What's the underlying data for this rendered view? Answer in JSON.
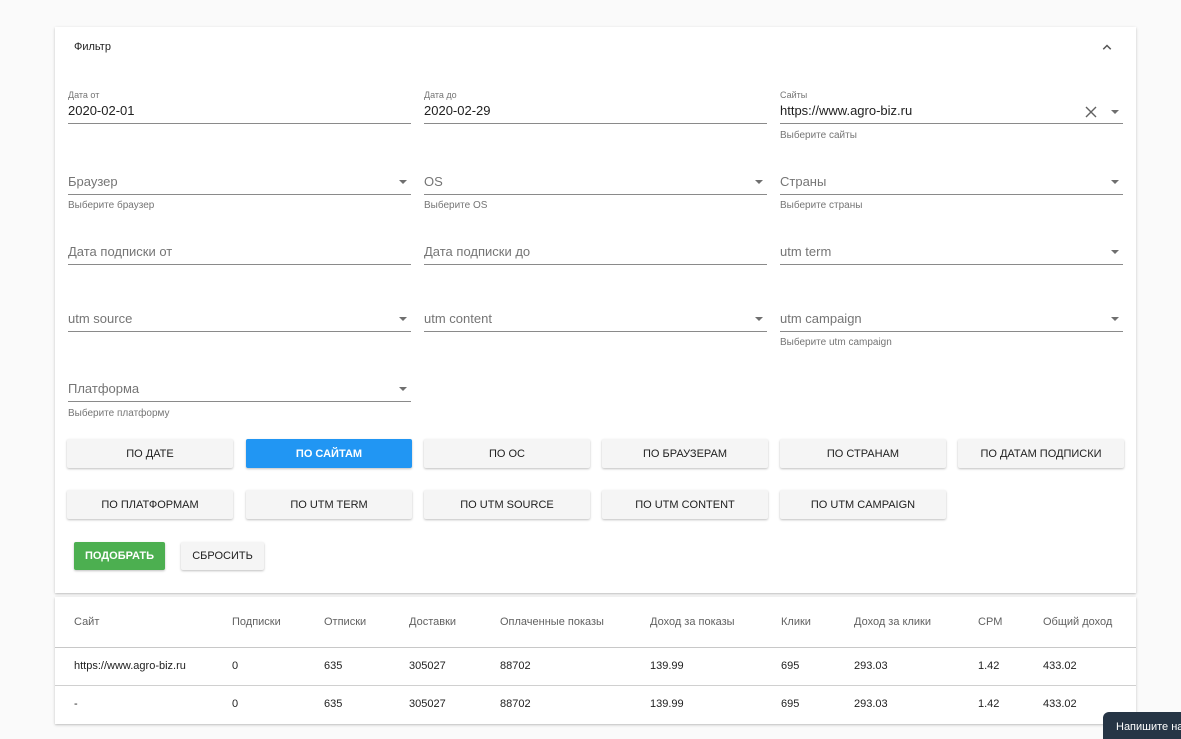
{
  "filter": {
    "title": "Фильтр",
    "fields": {
      "date_from": {
        "label": "Дата от",
        "value": "2020-02-01"
      },
      "date_to": {
        "label": "Дата до",
        "value": "2020-02-29"
      },
      "sites": {
        "label": "Сайты",
        "value": "https://www.agro-biz.ru",
        "hint": "Выберите сайты"
      },
      "browser": {
        "placeholder": "Браузер",
        "hint": "Выберите браузер"
      },
      "os": {
        "placeholder": "OS",
        "hint": "Выберите OS"
      },
      "countries": {
        "placeholder": "Страны",
        "hint": "Выберите страны"
      },
      "sub_date_from": {
        "placeholder": "Дата подписки от"
      },
      "sub_date_to": {
        "placeholder": "Дата подписки до"
      },
      "utm_term": {
        "placeholder": "utm term"
      },
      "utm_source": {
        "placeholder": "utm source"
      },
      "utm_content": {
        "placeholder": "utm content"
      },
      "utm_campaign": {
        "placeholder": "utm campaign",
        "hint": "Выберите utm campaign"
      },
      "platform": {
        "placeholder": "Платформа",
        "hint": "Выберите платформу"
      }
    },
    "group_buttons": [
      {
        "label": "ПО ДАТЕ",
        "active": false
      },
      {
        "label": "ПО САЙТАМ",
        "active": true
      },
      {
        "label": "ПО ОС",
        "active": false
      },
      {
        "label": "ПО БРАУЗЕРАМ",
        "active": false
      },
      {
        "label": "ПО СТРАНАМ",
        "active": false
      },
      {
        "label": "ПО ДАТАМ ПОДПИСКИ",
        "active": false
      },
      {
        "label": "ПО ПЛАТФОРМАМ",
        "active": false
      },
      {
        "label": "ПО UTM TERM",
        "active": false
      },
      {
        "label": "ПО UTM SOURCE",
        "active": false
      },
      {
        "label": "ПО UTM CONTENT",
        "active": false
      },
      {
        "label": "ПО UTM CAMPAIGN",
        "active": false
      }
    ],
    "apply_label": "ПОДОБРАТЬ",
    "reset_label": "СБРОСИТЬ"
  },
  "table": {
    "headers": [
      "Сайт",
      "Подписки",
      "Отписки",
      "Доставки",
      "Оплаченные показы",
      "Доход за показы",
      "Клики",
      "Доход за клики",
      "CPM",
      "Общий доход"
    ],
    "rows": [
      [
        "https://www.agro-biz.ru",
        "0",
        "635",
        "305027",
        "88702",
        "139.99",
        "695",
        "293.03",
        "1.42",
        "433.02"
      ],
      [
        "-",
        "0",
        "635",
        "305027",
        "88702",
        "139.99",
        "695",
        "293.03",
        "1.42",
        "433.02"
      ]
    ]
  },
  "chat": {
    "label": "Напишите на"
  },
  "colors": {
    "active_button": "#2196f3",
    "apply_button": "#4caf50",
    "chat_bg": "#263545"
  }
}
